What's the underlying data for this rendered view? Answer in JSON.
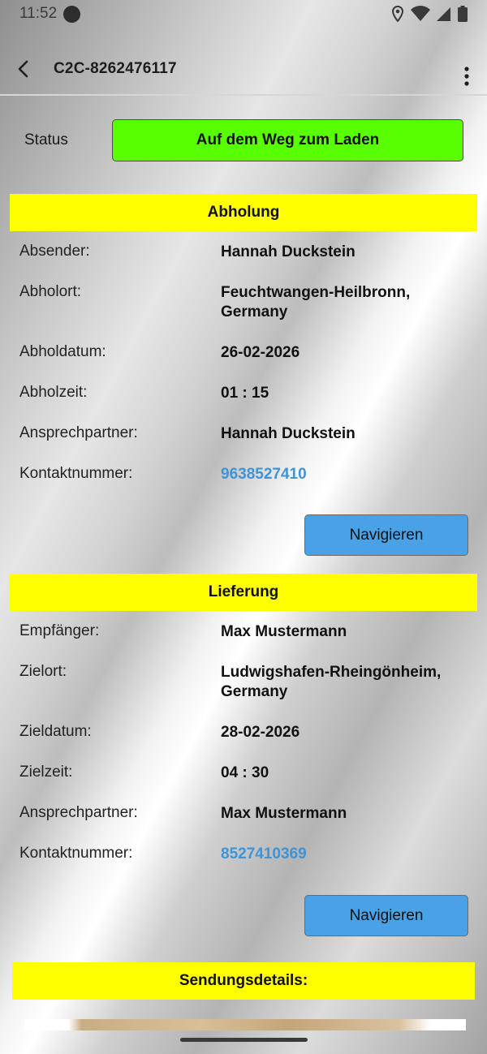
{
  "status_bar": {
    "time": "11:52"
  },
  "header": {
    "title": "C2C-8262476117"
  },
  "status": {
    "label": "Status",
    "value": "Auf dem Weg zum Laden",
    "color": "#57ff00"
  },
  "pickup": {
    "heading": "Abholung",
    "rows": [
      {
        "label": "Absender:",
        "value": "Hannah Duckstein"
      },
      {
        "label": "Abholort:",
        "value": "Feuchtwangen-Heilbronn, Germany"
      },
      {
        "label": "Abholdatum:",
        "value": "26-02-2026"
      },
      {
        "label": "Abholzeit:",
        "value": "01 : 15"
      },
      {
        "label": "Ansprechpartner:",
        "value": "Hannah Duckstein"
      },
      {
        "label": "Kontaktnummer:",
        "value": "9638527410"
      }
    ],
    "navigate_label": "Navigieren"
  },
  "delivery": {
    "heading": "Lieferung",
    "rows": [
      {
        "label": "Empfänger:",
        "value": "Max Mustermann"
      },
      {
        "label": "Zielort:",
        "value": "Ludwigshafen-Rheingönheim, Germany"
      },
      {
        "label": "Zieldatum:",
        "value": "28-02-2026"
      },
      {
        "label": "Zielzeit:",
        "value": "04 : 30"
      },
      {
        "label": "Ansprechpartner:",
        "value": "Max Mustermann"
      },
      {
        "label": "Kontaktnummer:",
        "value": "8527410369"
      }
    ],
    "navigate_label": "Navigieren"
  },
  "shipment": {
    "heading": "Sendungsdetails:"
  },
  "colors": {
    "section_header": "#ffff00",
    "link": "#3e94d6",
    "button": "#48a2e5"
  }
}
